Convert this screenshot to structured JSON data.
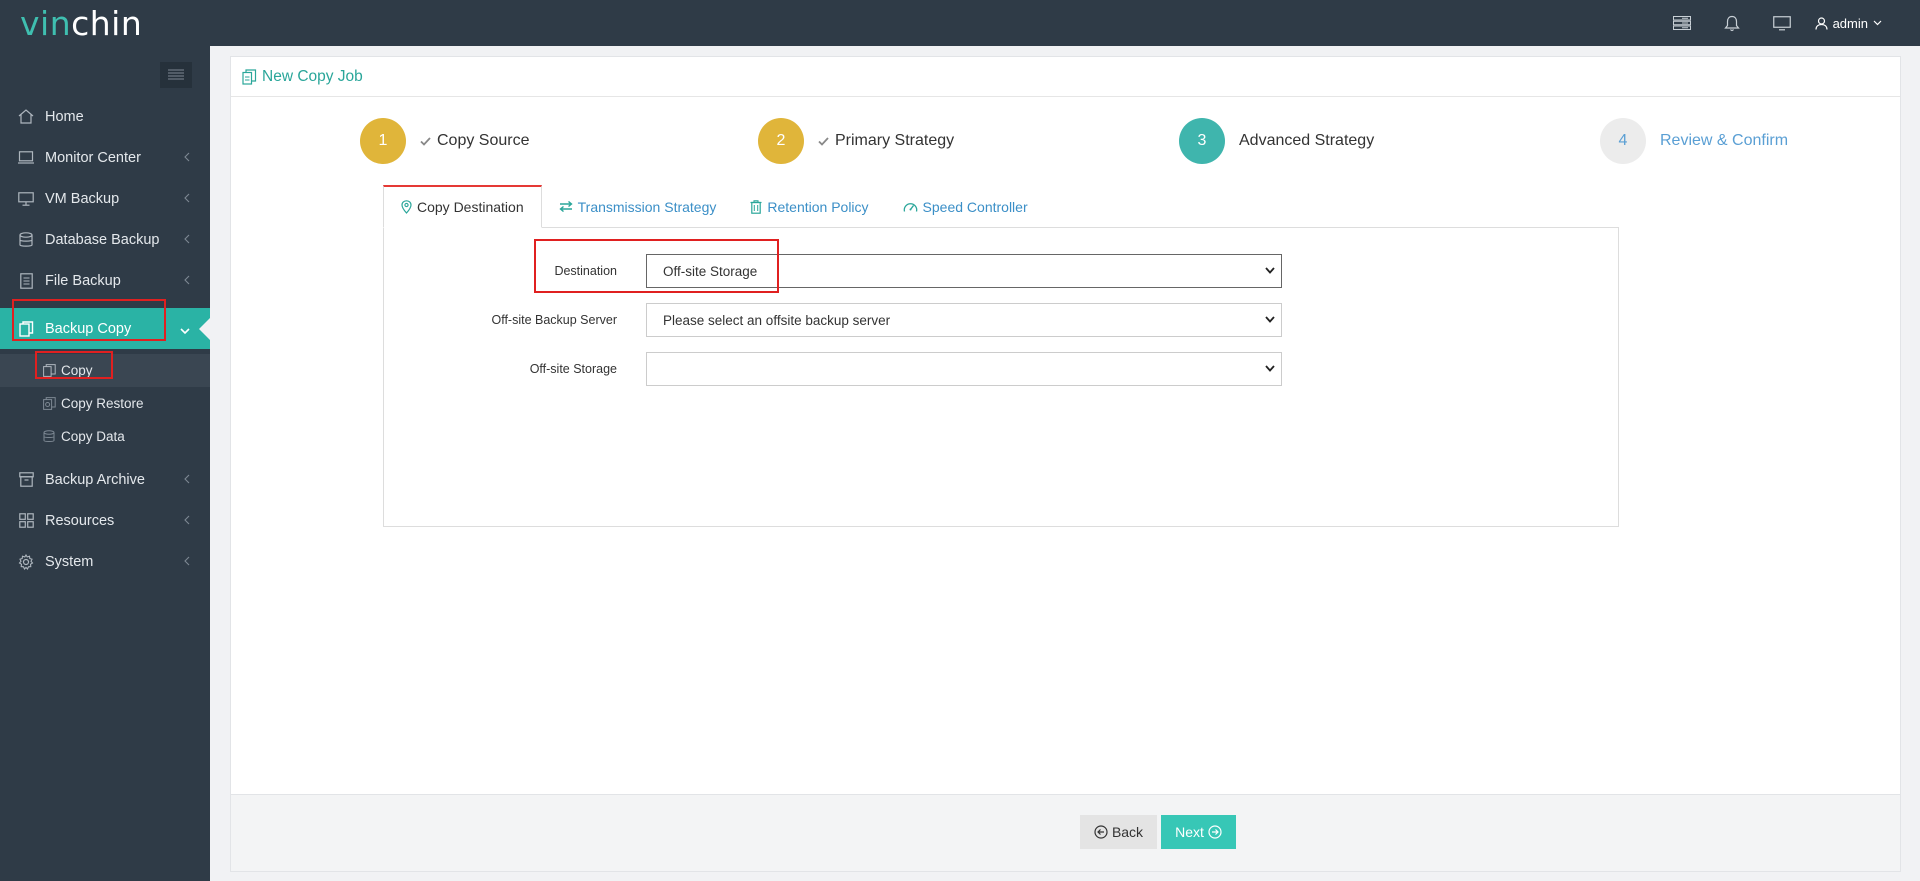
{
  "app": {
    "logo_part1": "vin",
    "logo_part2": "chin",
    "user": "admin"
  },
  "sidebar": {
    "items": [
      {
        "label": "Home",
        "icon": "home-icon"
      },
      {
        "label": "Monitor Center",
        "icon": "monitor-icon"
      },
      {
        "label": "VM Backup",
        "icon": "desktop-icon"
      },
      {
        "label": "Database Backup",
        "icon": "database-icon"
      },
      {
        "label": "File Backup",
        "icon": "file-icon"
      },
      {
        "label": "Backup Copy",
        "icon": "copy-icon"
      },
      {
        "label": "Backup Archive",
        "icon": "archive-icon"
      },
      {
        "label": "Resources",
        "icon": "grid-icon"
      },
      {
        "label": "System",
        "icon": "gear-icon"
      }
    ],
    "submenu": [
      {
        "label": "Copy",
        "icon": "copy-icon"
      },
      {
        "label": "Copy Restore",
        "icon": "restore-icon"
      },
      {
        "label": "Copy Data",
        "icon": "database-icon"
      }
    ]
  },
  "page": {
    "title": "New Copy Job"
  },
  "steps": [
    {
      "number": "1",
      "label": "Copy Source",
      "state": "done"
    },
    {
      "number": "2",
      "label": "Primary Strategy",
      "state": "done"
    },
    {
      "number": "3",
      "label": "Advanced Strategy",
      "state": "current"
    },
    {
      "number": "4",
      "label": "Review & Confirm",
      "state": "pending"
    }
  ],
  "tabs": [
    {
      "label": "Copy Destination",
      "icon": "location-pin-icon"
    },
    {
      "label": "Transmission Strategy",
      "icon": "transfer-arrows-icon"
    },
    {
      "label": "Retention Policy",
      "icon": "trash-icon"
    },
    {
      "label": "Speed Controller",
      "icon": "speedometer-icon"
    }
  ],
  "form": {
    "destination_label": "Destination",
    "destination_value": "Off-site Storage",
    "server_label": "Off-site Backup Server",
    "server_value": "Please select an offsite backup server",
    "storage_label": "Off-site Storage",
    "storage_value": ""
  },
  "buttons": {
    "back": "Back",
    "next": "Next"
  },
  "colors": {
    "accent_teal": "#2ab3a5",
    "step_done": "#e0b53a",
    "step_current": "#3fb5ad",
    "step_pending": "#ececec",
    "highlight_red": "#e02020",
    "sidebar_bg": "#2f3b47"
  }
}
